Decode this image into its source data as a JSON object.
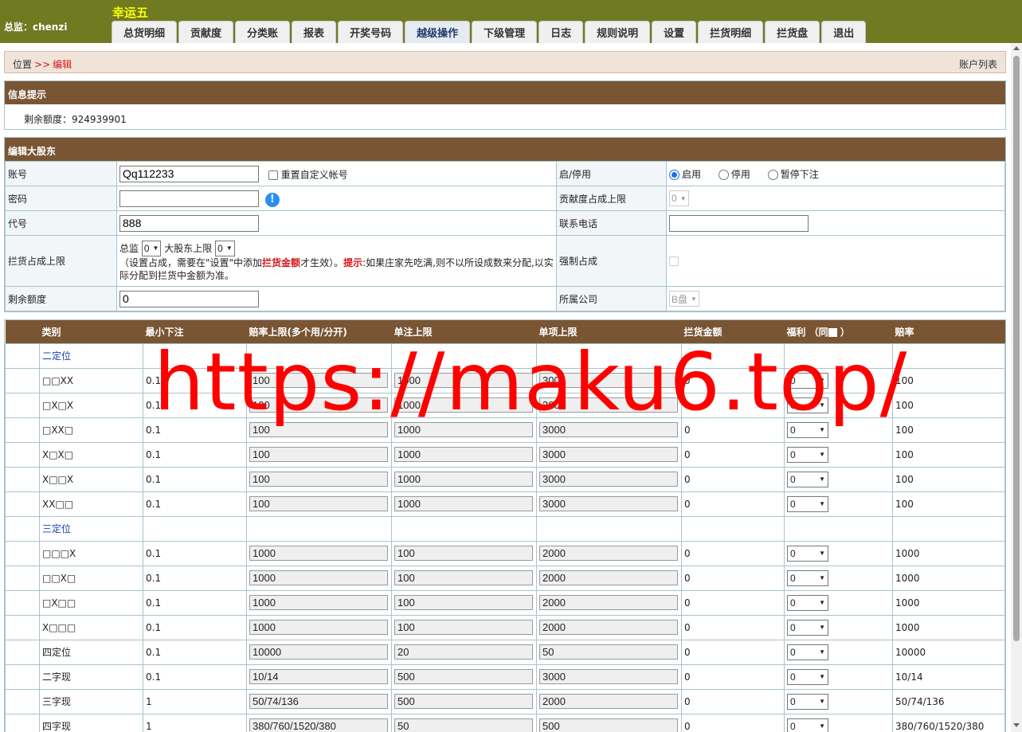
{
  "header": {
    "supervisor": "总监：chenzi",
    "brand": "幸运五",
    "tabs": [
      {
        "label": "总货明细",
        "active": false
      },
      {
        "label": "贡献度",
        "active": false
      },
      {
        "label": "分类账",
        "active": false
      },
      {
        "label": "报表",
        "active": false
      },
      {
        "label": "开奖号码",
        "active": false
      },
      {
        "label": "越级操作",
        "active": true
      },
      {
        "label": "下级管理",
        "active": false
      },
      {
        "label": "日志",
        "active": false
      },
      {
        "label": "规则说明",
        "active": false
      },
      {
        "label": "设置",
        "active": false
      },
      {
        "label": "拦货明细",
        "active": false
      },
      {
        "label": "拦货盘",
        "active": false
      },
      {
        "label": "退出",
        "active": false
      }
    ]
  },
  "breadcrumb": {
    "position": "位置",
    "arrow": ">>",
    "current": "编辑",
    "right_link": "账户列表"
  },
  "info": {
    "title": "信息提示",
    "remaining_label": "剩余额度：",
    "remaining_value": "924939901"
  },
  "edit": {
    "title": "编辑大股东",
    "account_label": "账号",
    "account_value": "Qq112233",
    "reset_label": "重置自定义帐号",
    "status_label": "启/停用",
    "status_options": [
      "启用",
      "停用",
      "暂停下注"
    ],
    "password_label": "密码",
    "contrib_label": "贡献度占成上限",
    "contrib_value": "0",
    "code_label": "代号",
    "code_value": "888",
    "phone_label": "联系电话",
    "block_label": "拦货占成上限",
    "block_sup_label": "总监",
    "block_sup_value": "0",
    "block_sh_label": "大股东上限",
    "block_sh_value": "0",
    "block_note_1": "（设置占成，需要在\"设置\"中添加",
    "block_note_red": "拦货金额",
    "block_note_2": "才生效）。",
    "block_note_hint": "提示",
    "block_note_3": ":如果庄家先吃满,则不以所设成数来分配,以实际分配到拦货中金额为准。",
    "force_label": "强制占成",
    "remain_label": "剩余额度",
    "remain_value": "0",
    "company_label": "所属公司",
    "company_value": "B盘"
  },
  "odds": {
    "headers": [
      "类别",
      "最小下注",
      "赔率上限(多个用/分开)",
      "单注上限",
      "单项上限",
      "拦货金额",
      "福利 （同",
      "）",
      "赔率"
    ],
    "rows": [
      {
        "group": true,
        "name": "二定位"
      },
      {
        "name": "□□XX",
        "min": "0.1",
        "odds": "100",
        "single": "1000",
        "item": "3000",
        "block": "0",
        "welfare": "0",
        "rate": "100"
      },
      {
        "name": "□X□X",
        "min": "0.1",
        "odds": "100",
        "single": "1000",
        "item": "3000",
        "block": "0",
        "welfare": "0",
        "rate": "100"
      },
      {
        "name": "□XX□",
        "min": "0.1",
        "odds": "100",
        "single": "1000",
        "item": "3000",
        "block": "0",
        "welfare": "0",
        "rate": "100"
      },
      {
        "name": "X□X□",
        "min": "0.1",
        "odds": "100",
        "single": "1000",
        "item": "3000",
        "block": "0",
        "welfare": "0",
        "rate": "100"
      },
      {
        "name": "X□□X",
        "min": "0.1",
        "odds": "100",
        "single": "1000",
        "item": "3000",
        "block": "0",
        "welfare": "0",
        "rate": "100"
      },
      {
        "name": "XX□□",
        "min": "0.1",
        "odds": "100",
        "single": "1000",
        "item": "3000",
        "block": "0",
        "welfare": "0",
        "rate": "100"
      },
      {
        "group": true,
        "name": "三定位"
      },
      {
        "name": "□□□X",
        "min": "0.1",
        "odds": "1000",
        "single": "100",
        "item": "2000",
        "block": "0",
        "welfare": "0",
        "rate": "1000"
      },
      {
        "name": "□□X□",
        "min": "0.1",
        "odds": "1000",
        "single": "100",
        "item": "2000",
        "block": "0",
        "welfare": "0",
        "rate": "1000"
      },
      {
        "name": "□X□□",
        "min": "0.1",
        "odds": "1000",
        "single": "100",
        "item": "2000",
        "block": "0",
        "welfare": "0",
        "rate": "1000"
      },
      {
        "name": "X□□□",
        "min": "0.1",
        "odds": "1000",
        "single": "100",
        "item": "2000",
        "block": "0",
        "welfare": "0",
        "rate": "1000"
      },
      {
        "name": "四定位",
        "min": "0.1",
        "odds": "10000",
        "single": "20",
        "item": "50",
        "block": "0",
        "welfare": "0",
        "rate": "10000"
      },
      {
        "name": "二字现",
        "min": "0.1",
        "odds": "10/14",
        "single": "500",
        "item": "3000",
        "block": "0",
        "welfare": "0",
        "rate": "10/14"
      },
      {
        "name": "三字现",
        "min": "1",
        "odds": "50/74/136",
        "single": "500",
        "item": "2000",
        "block": "0",
        "welfare": "0",
        "rate": "50/74/136"
      },
      {
        "name": "四字现",
        "min": "1",
        "odds": "380/760/1520/380",
        "single": "50",
        "item": "500",
        "block": "0",
        "welfare": "0",
        "rate": "380/760/1520/380"
      }
    ]
  },
  "watermark": "https://maku6.top/",
  "colors": {
    "header_bg": "#6f7a21",
    "brand": "#ffff00",
    "panel_head": "#7a5533",
    "accent_red": "#d8161b",
    "group_blue": "#1a3fb5"
  }
}
